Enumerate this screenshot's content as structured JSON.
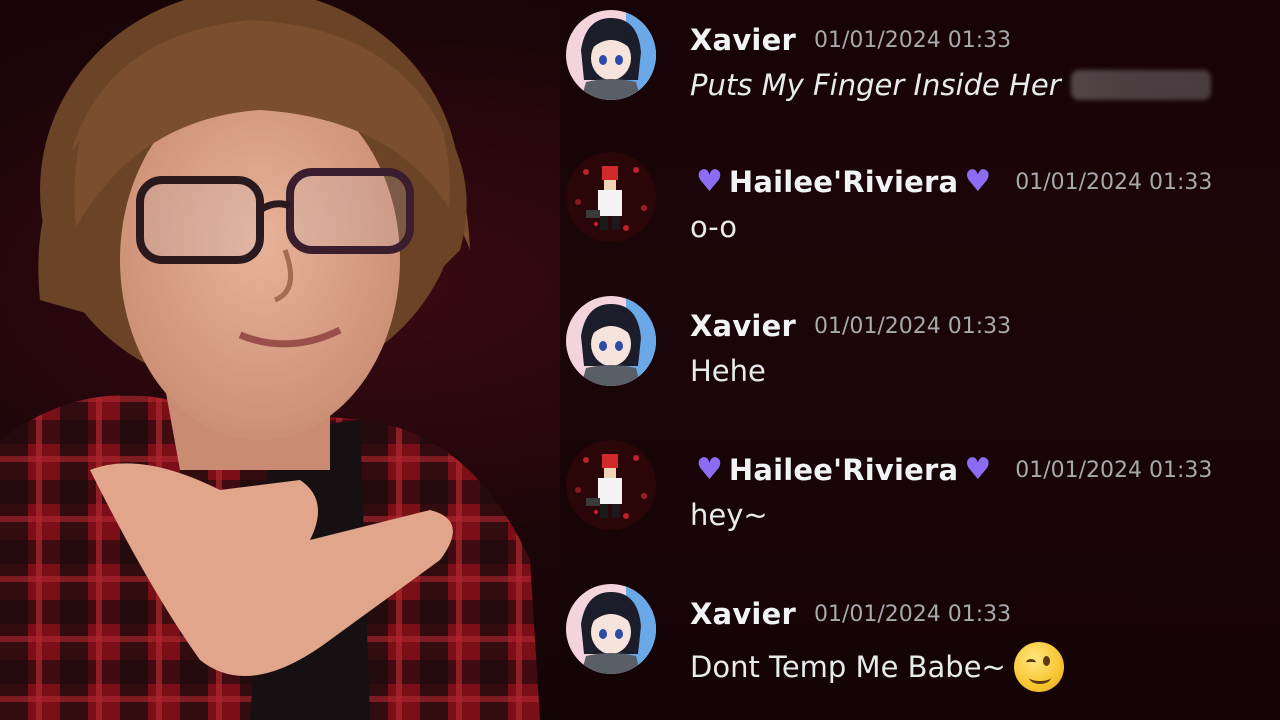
{
  "messages": [
    {
      "username": "Xavier",
      "timestamp": "01/01/2024 01:33",
      "text": "Puts My Finger Inside Her",
      "avatar": "anime-avatar"
    },
    {
      "username": "Hailee'Riviera",
      "timestamp": "01/01/2024 01:33",
      "text": "o-o",
      "avatar": "pixel-character-avatar"
    },
    {
      "username": "Xavier",
      "timestamp": "01/01/2024 01:33",
      "text": "Hehe",
      "avatar": "anime-avatar"
    },
    {
      "username": "Hailee'Riviera",
      "timestamp": "01/01/2024 01:33",
      "text": "hey~",
      "avatar": "pixel-character-avatar"
    },
    {
      "username": "Xavier",
      "timestamp": "01/01/2024 01:33",
      "text": "Dont Temp Me Babe~",
      "avatar": "anime-avatar",
      "emoji": "winking-face"
    }
  ],
  "icons": {
    "heart": "purple-heart",
    "heart_color": "#8c6cf2"
  },
  "colors": {
    "username": "#f2f3f5",
    "timestamp": "#a7a9ad",
    "text": "#e9eaec",
    "background": "#170407"
  }
}
